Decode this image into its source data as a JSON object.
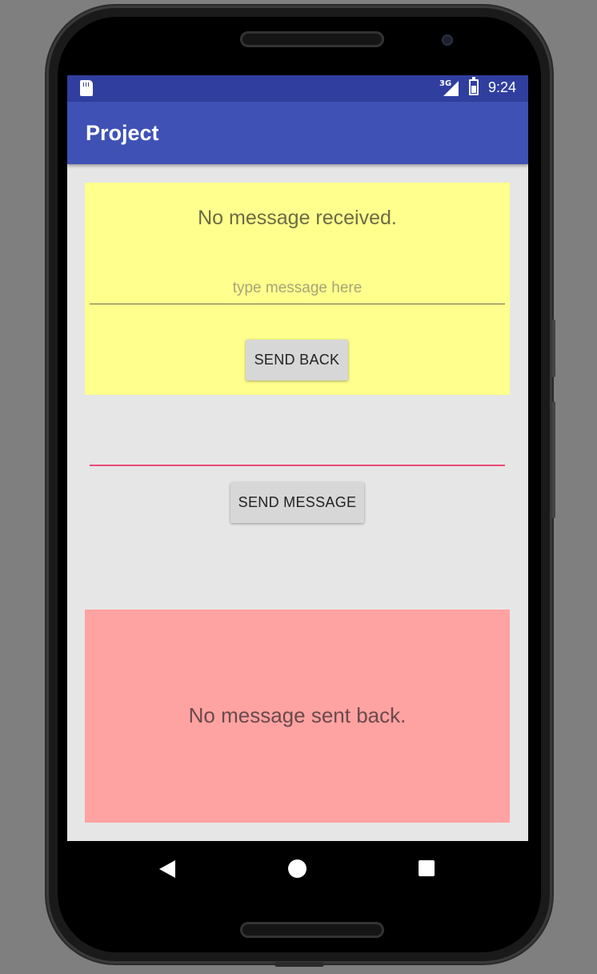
{
  "status_bar": {
    "network": "3G",
    "time": "9:24"
  },
  "app_bar": {
    "title": "Project"
  },
  "received_card": {
    "message": "No message received.",
    "reply_placeholder": "type message here",
    "send_back_label": "SEND BACK",
    "background": "#ffff8d"
  },
  "compose": {
    "value": "",
    "send_message_label": "SEND MESSAGE",
    "underline_color": "#e84c78"
  },
  "sent_back_card": {
    "message": "No message sent back.",
    "background": "#ffa2a2"
  },
  "colors": {
    "primary": "#3f51b5",
    "primary_dark": "#303f9f"
  },
  "nav_bar": {
    "icons": [
      "back-icon",
      "home-icon",
      "recents-icon"
    ]
  }
}
